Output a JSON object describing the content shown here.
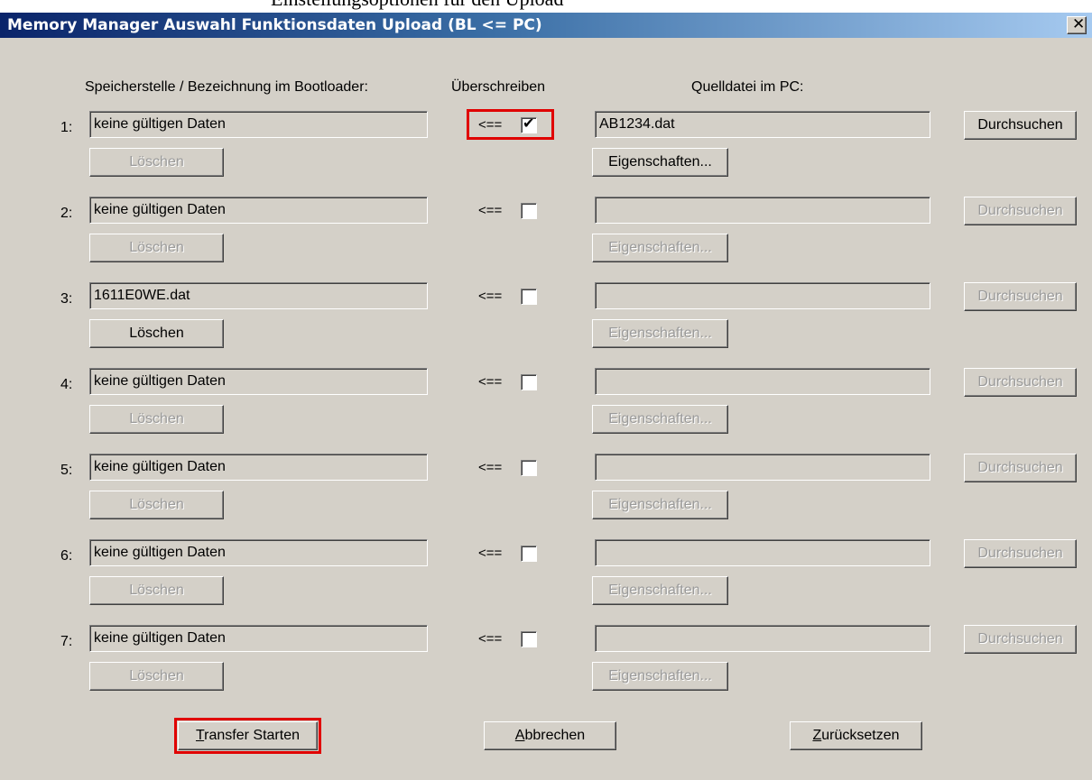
{
  "window": {
    "title": "Memory Manager Auswahl Funktionsdaten Upload (BL <= PC)",
    "close_glyph": "✕",
    "top_caption": "Einstellungsoptionen für den Upload"
  },
  "headers": {
    "bootloader": "Speicherstelle / Bezeichnung im Bootloader:",
    "overwrite": "Überschreiben",
    "source": "Quelldatei im PC:"
  },
  "rows": [
    {
      "num": "1:",
      "bootloader_value": "keine gültigen Daten",
      "delete_label": "Löschen",
      "delete_enabled": true,
      "arrow": "<==",
      "checked": true,
      "source_value": "AB1234.dat",
      "properties_label": "Eigenschaften...",
      "browse_label": "Durchsuchen",
      "enabled": true
    },
    {
      "num": "2:",
      "bootloader_value": "keine gültigen Daten",
      "delete_label": "Löschen",
      "arrow": "<==",
      "checked": false,
      "source_value": "",
      "properties_label": "Eigenschaften...",
      "browse_label": "Durchsuchen"
    },
    {
      "num": "3:",
      "bootloader_value": "1611E0WE.dat",
      "delete_label": "Löschen",
      "arrow": "<==",
      "checked": false,
      "source_value": "",
      "properties_label": "Eigenschaften...",
      "browse_label": "Durchsuchen"
    },
    {
      "num": "4:",
      "bootloader_value": "keine gültigen Daten",
      "delete_label": "Löschen",
      "arrow": "<==",
      "checked": false,
      "source_value": "",
      "properties_label": "Eigenschaften...",
      "browse_label": "Durchsuchen"
    },
    {
      "num": "5:",
      "bootloader_value": "keine gültigen Daten",
      "delete_label": "Löschen",
      "arrow": "<==",
      "checked": false,
      "source_value": "",
      "properties_label": "Eigenschaften...",
      "browse_label": "Durchsuchen"
    },
    {
      "num": "6:",
      "bootloader_value": "keine gültigen Daten",
      "delete_label": "Löschen",
      "arrow": "<==",
      "checked": false,
      "source_value": "",
      "properties_label": "Eigenschaften...",
      "browse_label": "Durchsuchen"
    },
    {
      "num": "7:",
      "bootloader_value": "keine gültigen Daten",
      "delete_label": "Löschen",
      "arrow": "<==",
      "checked": false,
      "source_value": "",
      "properties_label": "Eigenschaften...",
      "browse_label": "Durchsuchen"
    }
  ],
  "footer": {
    "transfer_pre": "",
    "transfer_u": "T",
    "transfer_post": "ransfer Starten",
    "cancel_pre": "",
    "cancel_u": "A",
    "cancel_post": "bbrechen",
    "reset_pre": "",
    "reset_u": "Z",
    "reset_post": "urücksetzen"
  },
  "colors": {
    "highlight": "#e00000",
    "titlebar_start": "#0a246a",
    "titlebar_end": "#a6caf0",
    "dialog_bg": "#d4d0c8"
  },
  "row_state": {
    "row1_delete_enabled": false,
    "row3_delete_enabled": true
  }
}
